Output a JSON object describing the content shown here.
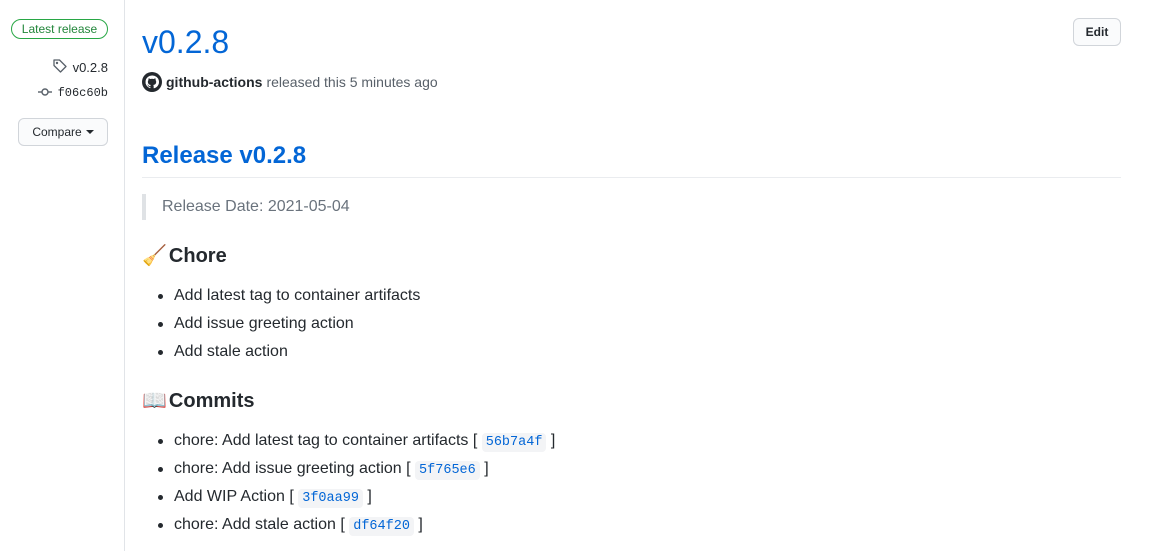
{
  "sidebar": {
    "badge": "Latest release",
    "tag": "v0.2.8",
    "commit": "f06c60b",
    "compare_label": "Compare"
  },
  "header": {
    "version": "v0.2.8",
    "author": "github-actions",
    "released_text": "released this 5 minutes ago",
    "edit_label": "Edit"
  },
  "body": {
    "release_title": "Release v0.2.8",
    "release_date": "Release Date: 2021-05-04",
    "chore_heading": "Chore",
    "chore_items": [
      "Add latest tag to container artifacts",
      "Add issue greeting action",
      "Add stale action"
    ],
    "commits_heading": "Commits",
    "commits": [
      {
        "text": "chore: Add latest tag to container artifacts",
        "sha": "56b7a4f"
      },
      {
        "text": "chore: Add issue greeting action",
        "sha": "5f765e6"
      },
      {
        "text": "Add WIP Action",
        "sha": "3f0aa99"
      },
      {
        "text": "chore: Add stale action",
        "sha": "df64f20"
      }
    ]
  },
  "icons": [
    "tag-icon",
    "commit-icon",
    "github-avatar-icon",
    "broom-emoji-icon",
    "book-emoji-icon",
    "caret-down-icon"
  ],
  "colors": {
    "link": "#0366d6",
    "badge_green": "#28a745"
  }
}
